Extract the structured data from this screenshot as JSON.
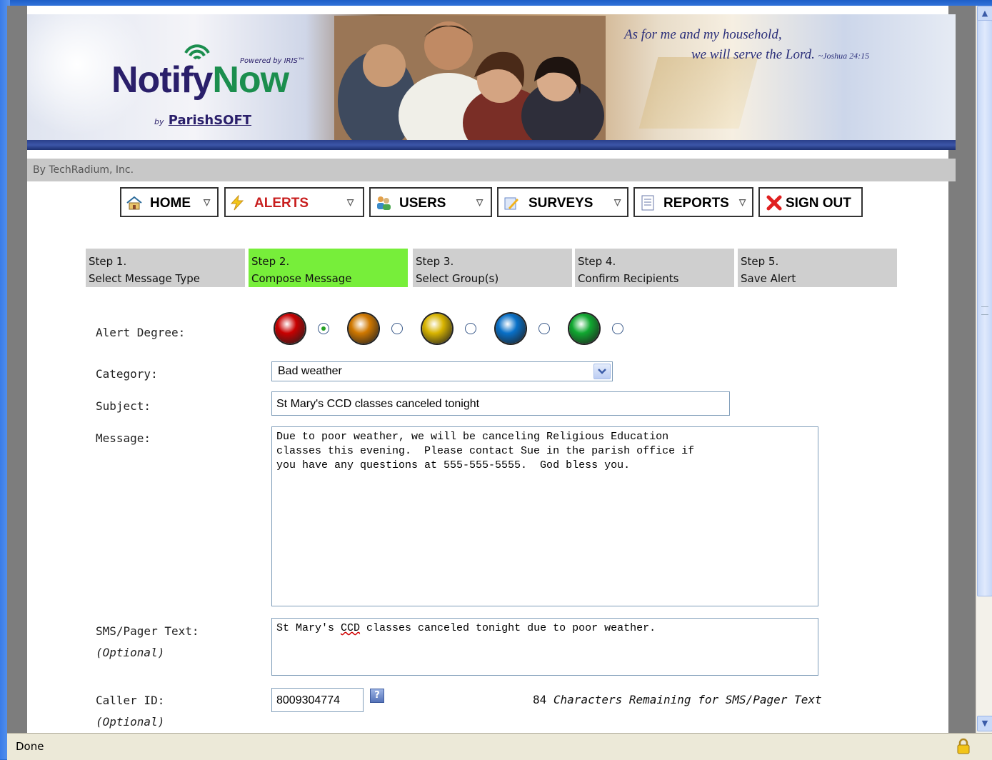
{
  "banner": {
    "logo_notify": "Notify",
    "logo_now": "Now",
    "powered_by": "Powered by IRIS™",
    "by": "by",
    "parishsoft": "ParishSOFT",
    "quote_line1": "As for me and my household,",
    "quote_line2": "we will serve the Lord.",
    "quote_ref": "~Joshua 24:15"
  },
  "byline": "By TechRadium, Inc.",
  "nav": {
    "home": "HOME",
    "alerts": "ALERTS",
    "users": "USERS",
    "surveys": "SURVEYS",
    "reports": "REPORTS",
    "sign_out": "SIGN OUT"
  },
  "steps": [
    {
      "num": "Step 1.",
      "label": "Select Message Type",
      "active": false
    },
    {
      "num": "Step 2.",
      "label": "Compose Message",
      "active": true
    },
    {
      "num": "Step 3.",
      "label": "Select Group(s)",
      "active": false
    },
    {
      "num": "Step 4.",
      "label": "Confirm Recipients",
      "active": false
    },
    {
      "num": "Step 5.",
      "label": "Save Alert",
      "active": false
    }
  ],
  "form": {
    "alert_degree_label": "Alert Degree:",
    "alert_degree_colors": [
      "#c80000",
      "#d07800",
      "#d8b400",
      "#0870c8",
      "#10a830"
    ],
    "alert_degree_selected": 0,
    "category_label": "Category:",
    "category_value": "Bad weather",
    "subject_label": "Subject:",
    "subject_value": "St Mary's CCD classes canceled tonight",
    "message_label": "Message:",
    "message_value": "Due to poor weather, we will be canceling Religious Education\nclasses this evening.  Please contact Sue in the parish office if\nyou have any questions at 555-555-5555.  God bless you.",
    "sms_label": "SMS/Pager Text:",
    "optional": "(Optional)",
    "sms_value_pre": "St Mary's ",
    "sms_value_flag": "CCD",
    "sms_value_post": " classes canceled tonight due to poor weather.",
    "callerid_label": "Caller ID:",
    "callerid_value": "8009304774",
    "help_glyph": "?",
    "remaining_count": "84",
    "remaining_text": "Characters Remaining for SMS/Pager Text"
  },
  "status": {
    "text": "Done"
  },
  "icons": {
    "home": "house-icon",
    "alerts": "lightning-icon",
    "users": "users-icon",
    "surveys": "survey-icon",
    "reports": "report-icon",
    "sign_out": "red-x-icon",
    "lock": "lock-icon"
  }
}
